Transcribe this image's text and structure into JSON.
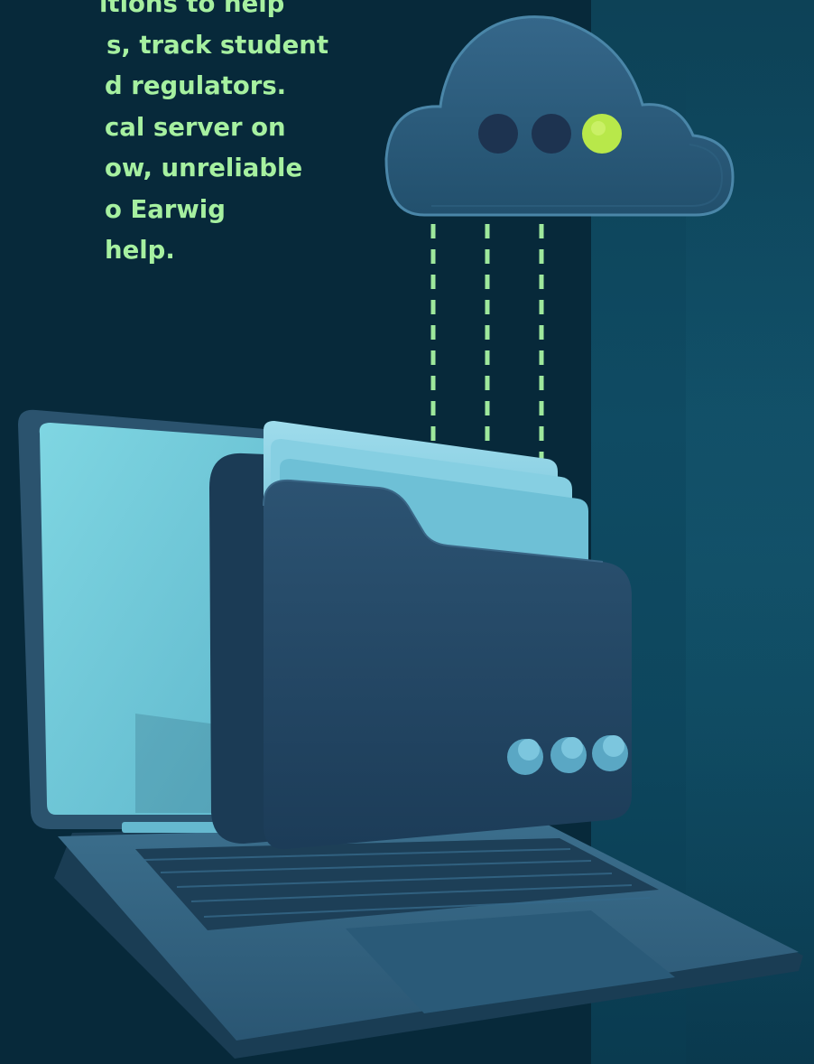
{
  "text_block": {
    "lines": [
      "itions to help",
      "s, track student",
      "d regulators.",
      "cal server on",
      "ow, unreliable",
      "o Earwig",
      "help."
    ]
  },
  "illustration": {
    "cloud": {
      "lights": [
        "off",
        "off",
        "on"
      ]
    },
    "folder": {
      "dots": 3
    },
    "icons": [
      "cloud-icon",
      "folder-icon",
      "laptop-icon"
    ]
  },
  "colors": {
    "background": "#07293a",
    "text": "#a6f0a0",
    "accent_light": "#b8e84a",
    "cloud": "#2a5775",
    "folder": "#234763",
    "laptop_screen": "#77cedb"
  }
}
